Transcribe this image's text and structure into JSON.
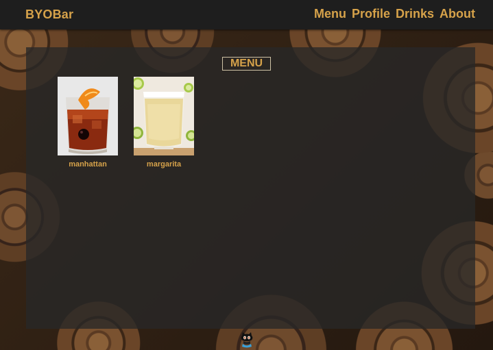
{
  "navbar": {
    "brand": "BYOBar",
    "links": [
      {
        "label": "Menu"
      },
      {
        "label": "Profile"
      },
      {
        "label": "Drinks"
      },
      {
        "label": "About"
      }
    ]
  },
  "panel": {
    "title": "MENU",
    "drinks": [
      {
        "name": "manhattan",
        "icon": "manhattan-cocktail-photo"
      },
      {
        "name": "margarita",
        "icon": "margarita-cocktail-photo"
      }
    ]
  },
  "footer": {
    "icon": "github-octocat-icon"
  },
  "colors": {
    "accent": "#d6a24a",
    "navbar_bg": "#1e1e1e",
    "panel_bg": "#282828"
  }
}
